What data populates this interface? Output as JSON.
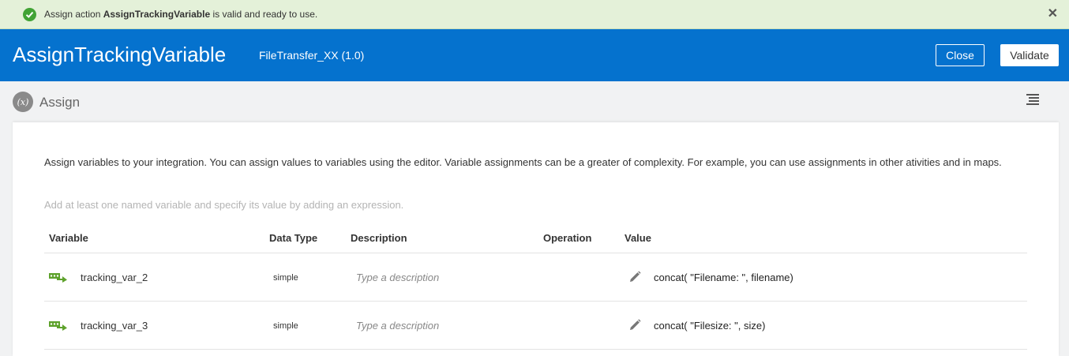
{
  "banner": {
    "message_prefix": "Assign action ",
    "action_name": "AssignTrackingVariable",
    "message_suffix": " is valid and ready to use.",
    "close_glyph": "✕",
    "status_color": "#41a335"
  },
  "header": {
    "title": "AssignTrackingVariable",
    "subtitle": "FileTransfer_XX (1.0)",
    "close_label": "Close",
    "validate_label": "Validate",
    "background_color": "#0572ce"
  },
  "section": {
    "icon_label": "(x)",
    "title": "Assign",
    "menu_icon": "list-menu-icon"
  },
  "panel": {
    "description": "Assign variables to your integration. You can assign values to variables using the editor. Variable assignments can be a greater of complexity. For example, you can use assignments in other ativities and in maps.",
    "hint": "Add at least one named variable and specify its value by adding an expression."
  },
  "table": {
    "headers": {
      "variable": "Variable",
      "data_type": "Data Type",
      "description": "Description",
      "operation": "Operation",
      "value": "Value"
    },
    "rows": [
      {
        "variable": "tracking_var_2",
        "data_type": "simple",
        "description_placeholder": "Type a description",
        "operation": "",
        "value": "concat( \"Filename: \", filename)"
      },
      {
        "variable": "tracking_var_3",
        "data_type": "simple",
        "description_placeholder": "Type a description",
        "operation": "",
        "value": "concat( \"Filesize: \", size)"
      }
    ]
  }
}
